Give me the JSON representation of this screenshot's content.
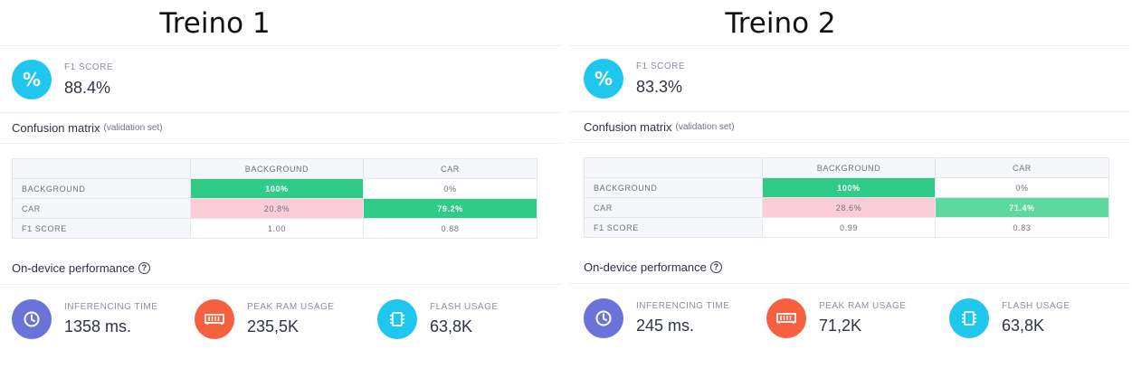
{
  "panels": [
    {
      "title": "Treino 1",
      "f1": {
        "label": "F1 SCORE",
        "value": "88.4%",
        "icon": "percent-icon"
      },
      "confusion": {
        "title": "Confusion matrix",
        "subtitle": "(validation set)",
        "columns": [
          "BACKGROUND",
          "CAR"
        ],
        "rows": [
          {
            "label": "BACKGROUND",
            "values": [
              "100%",
              "0%"
            ]
          },
          {
            "label": "CAR",
            "values": [
              "20.8%",
              "79.2%"
            ]
          },
          {
            "label": "F1 SCORE",
            "values": [
              "1.00",
              "0.88"
            ]
          }
        ]
      },
      "performance": {
        "title": "On-device performance",
        "metrics": [
          {
            "label": "INFERENCING TIME",
            "value": "1358 ms.",
            "icon": "clock-icon"
          },
          {
            "label": "PEAK RAM USAGE",
            "value": "235,5K",
            "icon": "ram-icon"
          },
          {
            "label": "FLASH USAGE",
            "value": "63,8K",
            "icon": "chip-icon"
          }
        ]
      }
    },
    {
      "title": "Treino 2",
      "f1": {
        "label": "F1 SCORE",
        "value": "83.3%",
        "icon": "percent-icon"
      },
      "confusion": {
        "title": "Confusion matrix",
        "subtitle": "(validation set)",
        "columns": [
          "BACKGROUND",
          "CAR"
        ],
        "rows": [
          {
            "label": "BACKGROUND",
            "values": [
              "100%",
              "0%"
            ]
          },
          {
            "label": "CAR",
            "values": [
              "28.6%",
              "71.4%"
            ]
          },
          {
            "label": "F1 SCORE",
            "values": [
              "0.99",
              "0.83"
            ]
          }
        ]
      },
      "performance": {
        "title": "On-device performance",
        "metrics": [
          {
            "label": "INFERENCING TIME",
            "value": "245 ms.",
            "icon": "clock-icon"
          },
          {
            "label": "PEAK RAM USAGE",
            "value": "71,2K",
            "icon": "ram-icon"
          },
          {
            "label": "FLASH USAGE",
            "value": "63,8K",
            "icon": "chip-icon"
          }
        ]
      }
    }
  ],
  "colors": {
    "accent_cyan": "#1fc6ee",
    "accent_indigo": "#6a73d8",
    "accent_orange": "#f7603f",
    "cell_strong_green": "#2ecc87",
    "cell_medium_green": "#5dd9a0",
    "cell_pink": "#fdcdd7"
  }
}
